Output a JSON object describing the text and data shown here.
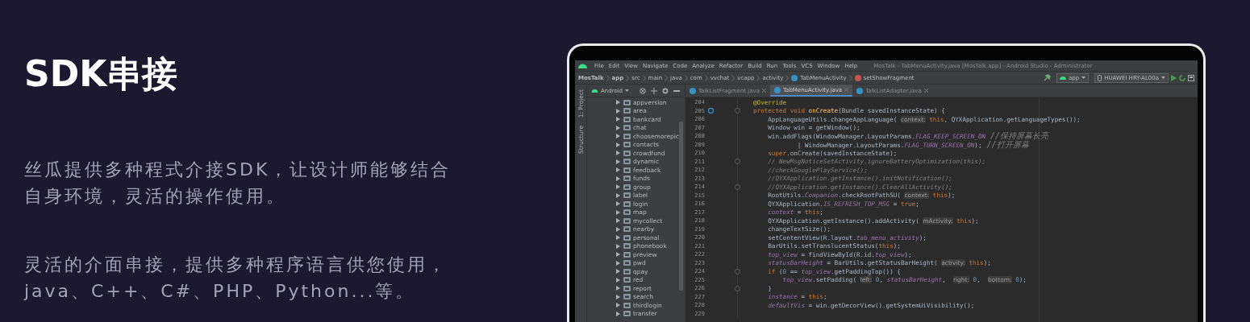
{
  "heading": "SDK串接",
  "paragraphs": [
    "丝瓜提供多种程式介接SDK，让设计师能够结合自身环境，灵活的操作使用。",
    "灵活的介面串接，提供多种程序语言供您使用，java、C++、C#、PHP、Python...等。"
  ],
  "ide": {
    "menu": [
      "File",
      "Edit",
      "View",
      "Navigate",
      "Code",
      "Analyze",
      "Refactor",
      "Build",
      "Run",
      "Tools",
      "VCS",
      "Window",
      "Help"
    ],
    "title": "MosTalk - TabMenuActivity.java [MosTalk.app] - Android Studio - Administrator",
    "breadcrumbs": [
      {
        "label": "MosTalk",
        "kind": "project"
      },
      {
        "label": "app",
        "kind": "module"
      },
      {
        "label": "src",
        "kind": "folder"
      },
      {
        "label": "main",
        "kind": "folder"
      },
      {
        "label": "java",
        "kind": "folder"
      },
      {
        "label": "com",
        "kind": "folder"
      },
      {
        "label": "vvchat",
        "kind": "folder"
      },
      {
        "label": "vcapp",
        "kind": "folder"
      },
      {
        "label": "activity",
        "kind": "folder"
      },
      {
        "label": "TabMenuActivity",
        "kind": "class"
      },
      {
        "label": "setShowFragment",
        "kind": "method"
      }
    ],
    "run_config": "app",
    "device": "HUAWEI HRY-AL00a",
    "side_tabs": [
      "1: Project",
      "Structure"
    ],
    "view_mode": "Android",
    "tree": [
      {
        "label": "appversion",
        "expanded": false
      },
      {
        "label": "area",
        "expanded": false
      },
      {
        "label": "bankcard",
        "expanded": false
      },
      {
        "label": "chat",
        "expanded": false
      },
      {
        "label": "choosemorepic",
        "expanded": false
      },
      {
        "label": "contacts",
        "expanded": false
      },
      {
        "label": "crowdfund",
        "expanded": false
      },
      {
        "label": "dynamic",
        "expanded": false
      },
      {
        "label": "feedback",
        "expanded": false
      },
      {
        "label": "funds",
        "expanded": false
      },
      {
        "label": "group",
        "expanded": false
      },
      {
        "label": "label",
        "expanded": false
      },
      {
        "label": "login",
        "expanded": false
      },
      {
        "label": "map",
        "expanded": false
      },
      {
        "label": "mycollect",
        "expanded": false
      },
      {
        "label": "nearby",
        "expanded": false
      },
      {
        "label": "personal",
        "expanded": false
      },
      {
        "label": "phonebook",
        "expanded": false
      },
      {
        "label": "preview",
        "expanded": false
      },
      {
        "label": "pwd",
        "expanded": false
      },
      {
        "label": "qpay",
        "expanded": false
      },
      {
        "label": "red",
        "expanded": false
      },
      {
        "label": "report",
        "expanded": false
      },
      {
        "label": "search",
        "expanded": false
      },
      {
        "label": "thirdlogin",
        "expanded": false
      },
      {
        "label": "transfer",
        "expanded": false
      }
    ],
    "editor_tabs": [
      {
        "label": "TalkListFragment.java",
        "selected": false
      },
      {
        "label": "TabMenuActivity.java",
        "selected": true
      },
      {
        "label": "TalkListAdapter.java",
        "selected": false
      }
    ],
    "lines": [
      {
        "number": "204",
        "segments": [
          {
            "kind": "annotation",
            "text": "@Override"
          }
        ]
      },
      {
        "number": "205",
        "override": true,
        "segments": [
          {
            "kind": "keyword",
            "text": "protected void "
          },
          {
            "kind": "function",
            "text": "onCreate"
          },
          {
            "kind": "plain",
            "text": "(Bundle savedInstanceState) {"
          }
        ]
      },
      {
        "number": "206",
        "segments": [
          {
            "kind": "plain",
            "text": "    AppLanguageUtils.changeAppLanguage( "
          },
          {
            "kind": "hint",
            "text": "context:"
          },
          {
            "kind": "keyword",
            "text": " this"
          },
          {
            "kind": "plain",
            "text": ", QYXApplication.getLanguageTypes());"
          }
        ]
      },
      {
        "number": "207",
        "segments": [
          {
            "kind": "plain",
            "text": "    Window win = getWindow();"
          }
        ]
      },
      {
        "number": "208",
        "segments": [
          {
            "kind": "plain",
            "text": "    win.addFlags(WindowManager.LayoutParams."
          },
          {
            "kind": "field",
            "text": "FLAG_KEEP_SCREEN_ON"
          },
          {
            "kind": "comment",
            "text": " //保持屏幕长亮"
          }
        ]
      },
      {
        "number": "209",
        "segments": [
          {
            "kind": "plain",
            "text": "            | WindowManager.LayoutParams."
          },
          {
            "kind": "field",
            "text": "FLAG_TURN_SCREEN_ON"
          },
          {
            "kind": "plain",
            "text": ");"
          },
          {
            "kind": "comment",
            "text": " //打开屏幕"
          }
        ]
      },
      {
        "number": "210",
        "segments": [
          {
            "kind": "keyword",
            "text": "    super"
          },
          {
            "kind": "plain",
            "text": ".onCreate(savedInstanceState);"
          }
        ]
      },
      {
        "number": "211",
        "fold": true,
        "segments": [
          {
            "kind": "comment",
            "text": "    // NewMsgNoticeSetActivity.ignoreBatteryOptimization(this);"
          }
        ]
      },
      {
        "number": "212",
        "segments": [
          {
            "kind": "comment",
            "text": "    //checkGooglePlayService();"
          }
        ]
      },
      {
        "number": "213",
        "segments": [
          {
            "kind": "comment",
            "text": "    //QYXApplication.getInstance().initNotification();"
          }
        ]
      },
      {
        "number": "214",
        "fold": true,
        "segments": [
          {
            "kind": "comment",
            "text": "    //QYXApplication.getInstance().ClearAllActivity();"
          }
        ]
      },
      {
        "number": "215",
        "segments": [
          {
            "kind": "plain",
            "text": "    RootUtils."
          },
          {
            "kind": "field",
            "text": "Companion"
          },
          {
            "kind": "plain",
            "text": ".checkRootPathSU( "
          },
          {
            "kind": "hint",
            "text": "context:"
          },
          {
            "kind": "keyword",
            "text": " this"
          },
          {
            "kind": "plain",
            "text": ");"
          }
        ]
      },
      {
        "number": "216",
        "segments": [
          {
            "kind": "plain",
            "text": "    QYXApplication."
          },
          {
            "kind": "field",
            "text": "IS_REFRESH_TOP_MSG"
          },
          {
            "kind": "plain",
            "text": " = "
          },
          {
            "kind": "keyword",
            "text": "true"
          },
          {
            "kind": "plain",
            "text": ";"
          }
        ]
      },
      {
        "number": "217",
        "segments": [
          {
            "kind": "field",
            "text": "    context"
          },
          {
            "kind": "plain",
            "text": " = "
          },
          {
            "kind": "keyword",
            "text": "this"
          },
          {
            "kind": "plain",
            "text": ";"
          }
        ]
      },
      {
        "number": "218",
        "segments": [
          {
            "kind": "plain",
            "text": "    QYXApplication.getInstance().addActivity( "
          },
          {
            "kind": "hint",
            "text": "mActivity:"
          },
          {
            "kind": "keyword",
            "text": " this"
          },
          {
            "kind": "plain",
            "text": ");"
          }
        ]
      },
      {
        "number": "219",
        "segments": [
          {
            "kind": "plain",
            "text": "    changeTextSize();"
          }
        ]
      },
      {
        "number": "220",
        "segments": [
          {
            "kind": "plain",
            "text": "    setContentView(R.layout."
          },
          {
            "kind": "field",
            "text": "tab_menu_activity"
          },
          {
            "kind": "plain",
            "text": ");"
          }
        ]
      },
      {
        "number": "221",
        "segments": [
          {
            "kind": "plain",
            "text": "    BarUtils.setTranslucentStatus("
          },
          {
            "kind": "keyword",
            "text": "this"
          },
          {
            "kind": "plain",
            "text": ");"
          }
        ]
      },
      {
        "number": "222",
        "segments": [
          {
            "kind": "field",
            "text": "    top_view"
          },
          {
            "kind": "plain",
            "text": " = findViewById(R.id."
          },
          {
            "kind": "field",
            "text": "top_view"
          },
          {
            "kind": "plain",
            "text": ");"
          }
        ]
      },
      {
        "number": "223",
        "segments": [
          {
            "kind": "field",
            "text": "    statusBarHeight"
          },
          {
            "kind": "plain",
            "text": " = BarUtils.getStatusBarHeight( "
          },
          {
            "kind": "hint",
            "text": "activity:"
          },
          {
            "kind": "keyword",
            "text": " this"
          },
          {
            "kind": "plain",
            "text": ");"
          }
        ]
      },
      {
        "number": "224",
        "fold": true,
        "segments": [
          {
            "kind": "keyword",
            "text": "    if"
          },
          {
            "kind": "plain",
            "text": " ("
          },
          {
            "kind": "number",
            "text": "0"
          },
          {
            "kind": "plain",
            "text": " == "
          },
          {
            "kind": "field",
            "text": "top_view"
          },
          {
            "kind": "plain",
            "text": ".getPaddingTop()) {"
          }
        ]
      },
      {
        "number": "225",
        "segments": [
          {
            "kind": "field",
            "text": "        top_view"
          },
          {
            "kind": "plain",
            "text": ".setPadding( "
          },
          {
            "kind": "hint",
            "text": "left:"
          },
          {
            "kind": "number",
            "text": " 0"
          },
          {
            "kind": "plain",
            "text": ", "
          },
          {
            "kind": "field",
            "text": "statusBarHeight"
          },
          {
            "kind": "plain",
            "text": ",  "
          },
          {
            "kind": "hint",
            "text": "right:"
          },
          {
            "kind": "number",
            "text": " 0"
          },
          {
            "kind": "plain",
            "text": ",  "
          },
          {
            "kind": "hint",
            "text": "bottom:"
          },
          {
            "kind": "number",
            "text": " 0"
          },
          {
            "kind": "plain",
            "text": ");"
          }
        ]
      },
      {
        "number": "226",
        "fold": true,
        "segments": [
          {
            "kind": "plain",
            "text": "    }"
          }
        ]
      },
      {
        "number": "227",
        "segments": [
          {
            "kind": "field",
            "text": "    instance"
          },
          {
            "kind": "plain",
            "text": " = "
          },
          {
            "kind": "keyword",
            "text": "this"
          },
          {
            "kind": "plain",
            "text": ";"
          }
        ]
      },
      {
        "number": "228",
        "segments": [
          {
            "kind": "field",
            "text": "    defaultVis"
          },
          {
            "kind": "plain",
            "text": " = win.getDecorView().getSystemUiVisibility();"
          }
        ]
      },
      {
        "number": "229"
      }
    ]
  }
}
